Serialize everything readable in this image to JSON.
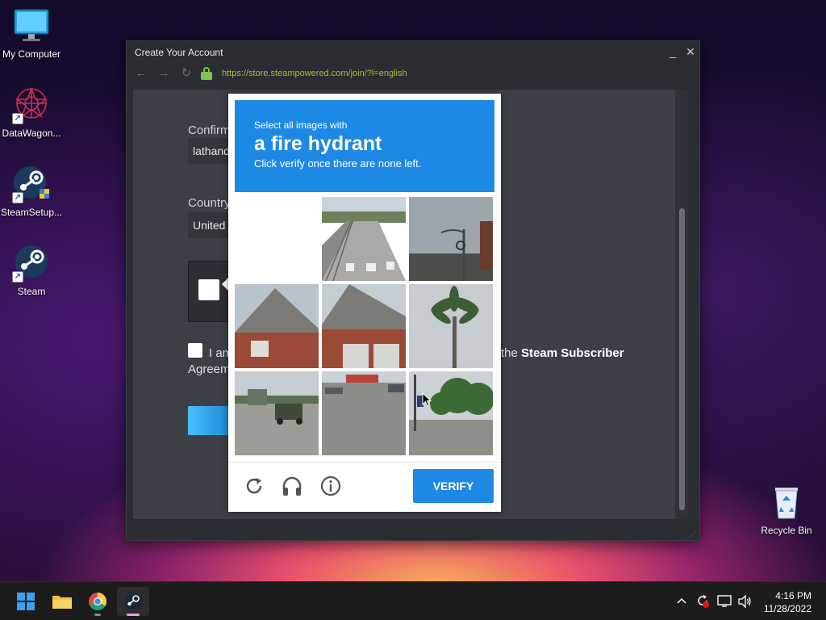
{
  "desktop": {
    "icons": [
      {
        "label": "My Computer"
      },
      {
        "label": "DataWagon..."
      },
      {
        "label": "SteamSetup..."
      },
      {
        "label": "Steam"
      },
      {
        "label": "Recycle Bin"
      }
    ]
  },
  "window": {
    "title": "Create Your Account",
    "minimize_label": "_",
    "close_label": "✕",
    "url": "https://store.steampowered.com/join/?l=english"
  },
  "form": {
    "confirm_label": "Confirm",
    "confirm_value": "lathand",
    "country_label": "Country",
    "country_value": "United",
    "agree_prefix": "I am",
    "agree_middle": "the",
    "agree_link": "Steam Subscriber",
    "agree_line2": "Agreem"
  },
  "captcha": {
    "prompt_small": "Select all images with",
    "prompt_big": "a fire hydrant",
    "prompt_hint": "Click verify once there are none left.",
    "verify_label": "VERIFY",
    "tiles": [
      {
        "desc": "blank"
      },
      {
        "desc": "railroad-street"
      },
      {
        "desc": "street-light"
      },
      {
        "desc": "brick-house-roof"
      },
      {
        "desc": "brick-garage"
      },
      {
        "desc": "palm-tree"
      },
      {
        "desc": "highway-truck"
      },
      {
        "desc": "parking-lot"
      },
      {
        "desc": "intersection-trees"
      }
    ]
  },
  "taskbar": {
    "time": "4:16 PM",
    "date": "11/28/2022"
  },
  "colors": {
    "accent": "#1e88e5",
    "url_green": "#9bc53d"
  }
}
